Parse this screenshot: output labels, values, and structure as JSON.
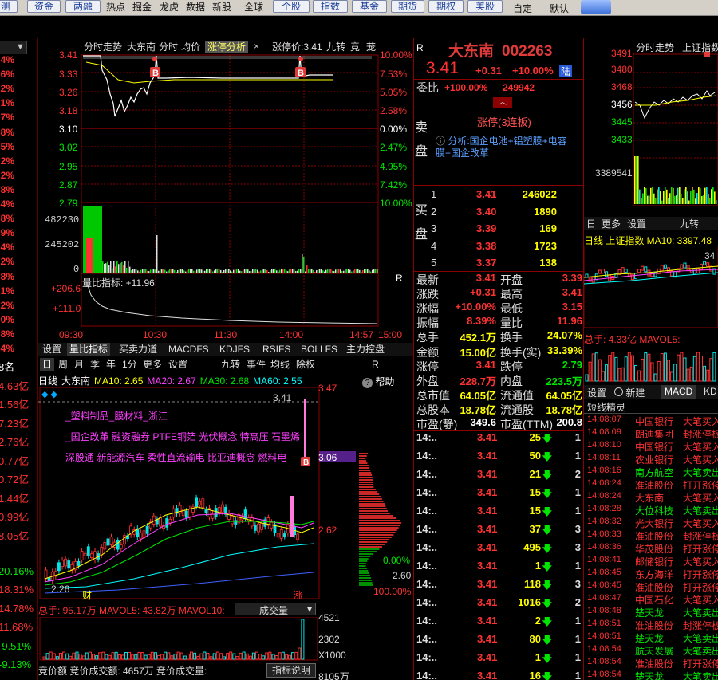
{
  "toolbar": {
    "buttons": [
      "测",
      "资金",
      "两融",
      "个股",
      "指数",
      "基金",
      "期货",
      "期权",
      "美股"
    ],
    "texts": [
      "热点",
      "掘金",
      "龙虎",
      "数据",
      "新股",
      "全球",
      "自定",
      "默认"
    ]
  },
  "left_column": {
    "pct_top": [
      "4%",
      "6%",
      "2%",
      "1%",
      "7%",
      "8%",
      "5%",
      "2%",
      "2%",
      "8%",
      "4%",
      "8%",
      "9%",
      "4%",
      "2%",
      "8%",
      "1%",
      "2%",
      "0%",
      "8%",
      "4%"
    ],
    "caps": [
      {
        "t": "8名",
        "c": "white"
      },
      {
        "t": "4.63亿",
        "c": "red"
      },
      {
        "t": "1.56亿",
        "c": "red"
      },
      {
        "t": "7.23亿",
        "c": "red"
      },
      {
        "t": "2.76亿",
        "c": "red"
      },
      {
        "t": "0.77亿",
        "c": "red"
      },
      {
        "t": "0.72亿",
        "c": "red"
      },
      {
        "t": "1.44亿",
        "c": "red"
      },
      {
        "t": "0.99亿",
        "c": "red"
      },
      {
        "t": "8.05亿",
        "c": "red"
      },
      {
        "t": "",
        "c": "red"
      },
      {
        "t": "20.16%",
        "c": "green"
      },
      {
        "t": "18.31%",
        "c": "red"
      },
      {
        "t": "14.78%",
        "c": "red"
      },
      {
        "t": "11.68%",
        "c": "red"
      },
      {
        "t": "-9.51%",
        "c": "green"
      },
      {
        "t": "-9.13%",
        "c": "green"
      }
    ]
  },
  "intraday": {
    "tabs": [
      "分时走势",
      "大东南",
      "分时",
      "均价",
      "涨停分析",
      "涨停价:3.41",
      "九转",
      "竞",
      "茏"
    ],
    "price_ticks": [
      "3.41",
      "3.33",
      "3.26",
      "3.18",
      "3.10",
      "3.02",
      "2.95",
      "2.87",
      "2.79"
    ],
    "pct_ticks": [
      "10.00%",
      "7.53%",
      "5.05%",
      "2.58%",
      "0.00%",
      "2.47%",
      "4.95%",
      "7.42%",
      "10.00%"
    ],
    "vol_ticks": [
      "482230",
      "245202",
      "0"
    ],
    "ratio_label": "量比指标: +11.96",
    "ratio_ticks": [
      "+206.6",
      "+111.0"
    ],
    "time_ticks": [
      "09:30",
      "10:30",
      "11:30",
      "14:00",
      "14:57",
      "15:00"
    ],
    "marker_b": "B"
  },
  "lower_tabs": [
    "设置",
    "量比指标",
    "买卖力道",
    "MACDFS",
    "KDJFS",
    "RSIFS",
    "BOLLFS",
    "主力控盘"
  ],
  "kline": {
    "period_tabs": [
      "日",
      "周",
      "月",
      "季",
      "年",
      "1分",
      "更多",
      "设置",
      "九转",
      "事件",
      "均线",
      "除权"
    ],
    "ma_line": [
      {
        "t": "日线",
        "c": "white"
      },
      {
        "t": "大东南",
        "c": "white"
      },
      {
        "t": "MA10: 2.65",
        "c": "yellow"
      },
      {
        "t": "MA20: 2.67",
        "c": "magenta"
      },
      {
        "t": "MA30: 2.68",
        "c": "green"
      },
      {
        "t": "MA60: 2.55",
        "c": "cyan"
      }
    ],
    "industry": "_塑料制品_膜材料_浙江",
    "concepts_1": "_国企改革 融资融券 PTFE铜箔 光伏概念 特高压 石墨烯",
    "concepts_2": "深股通 新能源汽车 柔性直流输电 比亚迪概念 燃料电",
    "price_labels": [
      "3.41",
      "3.47",
      "3.06",
      "2.62",
      "2.60",
      "2.26"
    ],
    "chip_pct": [
      "0.00%",
      "100.00%"
    ],
    "help": "帮助",
    "bottom_marks": [
      "财",
      "涨"
    ],
    "vol_line": "总手: 95.17万 MAVOL5: 43.82万 MAVOL10:",
    "vol_select": "成交量",
    "vol_ticks": [
      "4521",
      "2302",
      "X1000"
    ],
    "bottom_line": "竞价额 竞价成交额: 4657万 竞价成交量:",
    "indicator_btn": "指标说明",
    "bottom_tick": "8105万"
  },
  "quote": {
    "name": "大东南",
    "code": "002263",
    "price": "3.41",
    "change": "+0.31",
    "pct": "+10.00%",
    "tag": "陆",
    "weibi_label": "委比",
    "weibi_pct": "+100.00%",
    "weibi_vol": "249942",
    "sell_label": "卖盘",
    "limit_up": "涨停(3连板)",
    "analysis": "分析:国企电池+铝塑膜+电容膜+国企改革",
    "buy_label": "买盘",
    "bids": [
      {
        "n": "1",
        "p": "3.41",
        "v": "246022"
      },
      {
        "n": "2",
        "p": "3.40",
        "v": "1890"
      },
      {
        "n": "3",
        "p": "3.39",
        "v": "169"
      },
      {
        "n": "4",
        "p": "3.38",
        "v": "1723"
      },
      {
        "n": "5",
        "p": "3.37",
        "v": "138"
      }
    ],
    "stats": [
      {
        "l": "最新",
        "v": "3.41",
        "vc": "red",
        "l2": "开盘",
        "v2": "3.39",
        "v2c": "red"
      },
      {
        "l": "涨跌",
        "v": "+0.31",
        "vc": "red",
        "l2": "最高",
        "v2": "3.41",
        "v2c": "red"
      },
      {
        "l": "涨幅",
        "v": "+10.00%",
        "vc": "red",
        "l2": "最低",
        "v2": "3.15",
        "v2c": "red"
      },
      {
        "l": "振幅",
        "v": "8.39%",
        "vc": "red",
        "l2": "量比",
        "v2": "11.96",
        "v2c": "red"
      },
      {
        "l": "总手",
        "v": "452.1万",
        "vc": "yellow",
        "l2": "换手",
        "v2": "24.07%",
        "v2c": "yellow"
      },
      {
        "l": "金额",
        "v": "15.00亿",
        "vc": "yellow",
        "l2": "换手(实)",
        "v2": "33.39%",
        "v2c": "yellow"
      },
      {
        "l": "涨停",
        "v": "3.41",
        "vc": "red",
        "l2": "跌停",
        "v2": "2.79",
        "v2c": "green"
      },
      {
        "l": "外盘",
        "v": "228.7万",
        "vc": "red",
        "l2": "内盘",
        "v2": "223.5万",
        "v2c": "green"
      },
      {
        "l": "总市值",
        "v": "64.05亿",
        "vc": "yellow",
        "l2": "流通值",
        "v2": "64.05亿",
        "v2c": "yellow"
      },
      {
        "l": "总股本",
        "v": "18.78亿",
        "vc": "yellow",
        "l2": "流通股",
        "v2": "18.78亿",
        "v2c": "yellow"
      },
      {
        "l": "市盈(静)",
        "v": "349.6",
        "vc": "white",
        "l2": "市盈(TTM)",
        "v2": "200.8",
        "v2c": "white"
      }
    ],
    "ticks": [
      {
        "t": "14:..",
        "p": "3.41",
        "v": "25",
        "d": "down",
        "k": "1"
      },
      {
        "t": "14:..",
        "p": "3.41",
        "v": "50",
        "d": "down",
        "k": "1"
      },
      {
        "t": "14:..",
        "p": "3.41",
        "v": "21",
        "d": "down",
        "k": "2"
      },
      {
        "t": "14:..",
        "p": "3.41",
        "v": "15",
        "d": "down",
        "k": "1"
      },
      {
        "t": "14:..",
        "p": "3.41",
        "v": "15",
        "d": "down",
        "k": "1"
      },
      {
        "t": "14:..",
        "p": "3.41",
        "v": "37",
        "d": "down",
        "k": "3"
      },
      {
        "t": "14:..",
        "p": "3.41",
        "v": "495",
        "d": "down",
        "k": "3"
      },
      {
        "t": "14:..",
        "p": "3.41",
        "v": "1",
        "d": "down",
        "k": "1"
      },
      {
        "t": "14:..",
        "p": "3.41",
        "v": "118",
        "d": "down",
        "k": "3"
      },
      {
        "t": "14:..",
        "p": "3.41",
        "v": "1016",
        "d": "down",
        "k": "2"
      },
      {
        "t": "14:..",
        "p": "3.41",
        "v": "2",
        "d": "down",
        "k": "1"
      },
      {
        "t": "14:..",
        "p": "3.41",
        "v": "80",
        "d": "down",
        "k": "1"
      },
      {
        "t": "14:..",
        "p": "3.41",
        "v": "1",
        "d": "down",
        "k": "1"
      },
      {
        "t": "14:..",
        "p": "3.41",
        "v": "16",
        "d": "down",
        "k": "1"
      }
    ]
  },
  "index_panel": {
    "tabs": [
      "分时走势",
      "上证指数",
      "九转"
    ],
    "price_ticks": [
      "3491",
      "3480",
      "3468",
      "3456",
      "3445",
      "3433"
    ],
    "vol_tick": "3389541",
    "sub_tabs": [
      "日",
      "更多",
      "设置",
      "九转"
    ],
    "ma_line": "日线 上证指数 MA10: 3397.48",
    "small_tick": "34",
    "vol_line": "总手: 4.33亿 MAVOL5:"
  },
  "news": {
    "tabs": [
      "设置",
      "新建",
      "MACD",
      "KD"
    ],
    "title": "短线精灵",
    "items": [
      {
        "t": "14:08:07",
        "n": "中国银行",
        "a": "大笔买入"
      },
      {
        "t": "14:08:09",
        "n": "朗迪集团",
        "a": "封涨停板"
      },
      {
        "t": "14:08:10",
        "n": "中国银行",
        "a": "大笔买入"
      },
      {
        "t": "14:08:11",
        "n": "农业银行",
        "a": "大笔买入"
      },
      {
        "t": "14:08:16",
        "n": "南方航空",
        "a": "大笔卖出"
      },
      {
        "t": "14:08:24",
        "n": "准油股份",
        "a": "打开涨停板"
      },
      {
        "t": "14:08:24",
        "n": "大东南",
        "a": "大笔买入"
      },
      {
        "t": "14:08:28",
        "n": "大位科技",
        "a": "大笔卖出"
      },
      {
        "t": "14:08:32",
        "n": "光大银行",
        "a": "大笔买入"
      },
      {
        "t": "14:08:33",
        "n": "准油股份",
        "a": "封涨停板"
      },
      {
        "t": "14:08:36",
        "n": "华茂股份",
        "a": "打开涨停板"
      },
      {
        "t": "14:08:41",
        "n": "邮储银行",
        "a": "大笔买入"
      },
      {
        "t": "14:08:45",
        "n": "东方海洋",
        "a": "打开涨停板"
      },
      {
        "t": "14:08:45",
        "n": "准油股份",
        "a": "打开涨停板"
      },
      {
        "t": "14:08:47",
        "n": "中国石化",
        "a": "大笔买入"
      },
      {
        "t": "14:08:48",
        "n": "楚天龙",
        "a": "大笔卖出"
      },
      {
        "t": "14:08:51",
        "n": "准油股份",
        "a": "封涨停板"
      },
      {
        "t": "14:08:51",
        "n": "楚天龙",
        "a": "大笔卖出"
      },
      {
        "t": "14:08:54",
        "n": "航天发展",
        "a": "大笔卖出"
      },
      {
        "t": "14:08:54",
        "n": "准油股份",
        "a": "打开涨停板"
      },
      {
        "t": "14:08:54",
        "n": "楚天龙",
        "a": "大笔卖出"
      }
    ]
  },
  "colors": {
    "up": "#ff3232",
    "down": "#00e600",
    "ma10": "#ffff00",
    "ma20": "#ff40ff",
    "ma30": "#00e600",
    "ma60": "#00ffff",
    "grid": "#8b0000"
  }
}
